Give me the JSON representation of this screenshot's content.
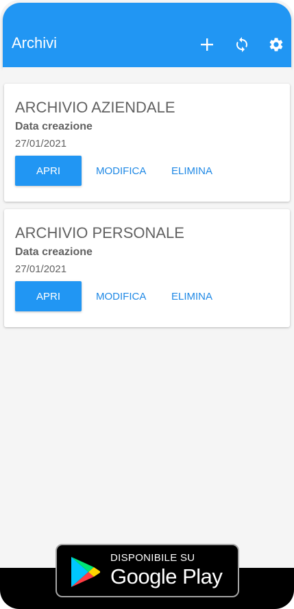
{
  "appbar": {
    "title": "Archivi",
    "actions": [
      {
        "icon": "add-icon"
      },
      {
        "icon": "sync-icon"
      },
      {
        "icon": "settings-icon"
      }
    ],
    "color": "#2196F3"
  },
  "archives": [
    {
      "name": "ARCHIVIO AZIENDALE",
      "date_label": "Data creazione",
      "date": "27/01/2021",
      "open_label": "APRI",
      "edit_label": "MODIFICA",
      "delete_label": "ELIMINA"
    },
    {
      "name": "ARCHIVIO PERSONALE",
      "date_label": "Data creazione",
      "date": "27/01/2021",
      "open_label": "APRI",
      "edit_label": "MODIFICA",
      "delete_label": "ELIMINA"
    }
  ],
  "badge": {
    "line1": "DISPONIBILE SU",
    "line2": "Google Play"
  },
  "colors": {
    "accent": "#2196F3",
    "link": "#1E88E5",
    "text": "#616161"
  }
}
